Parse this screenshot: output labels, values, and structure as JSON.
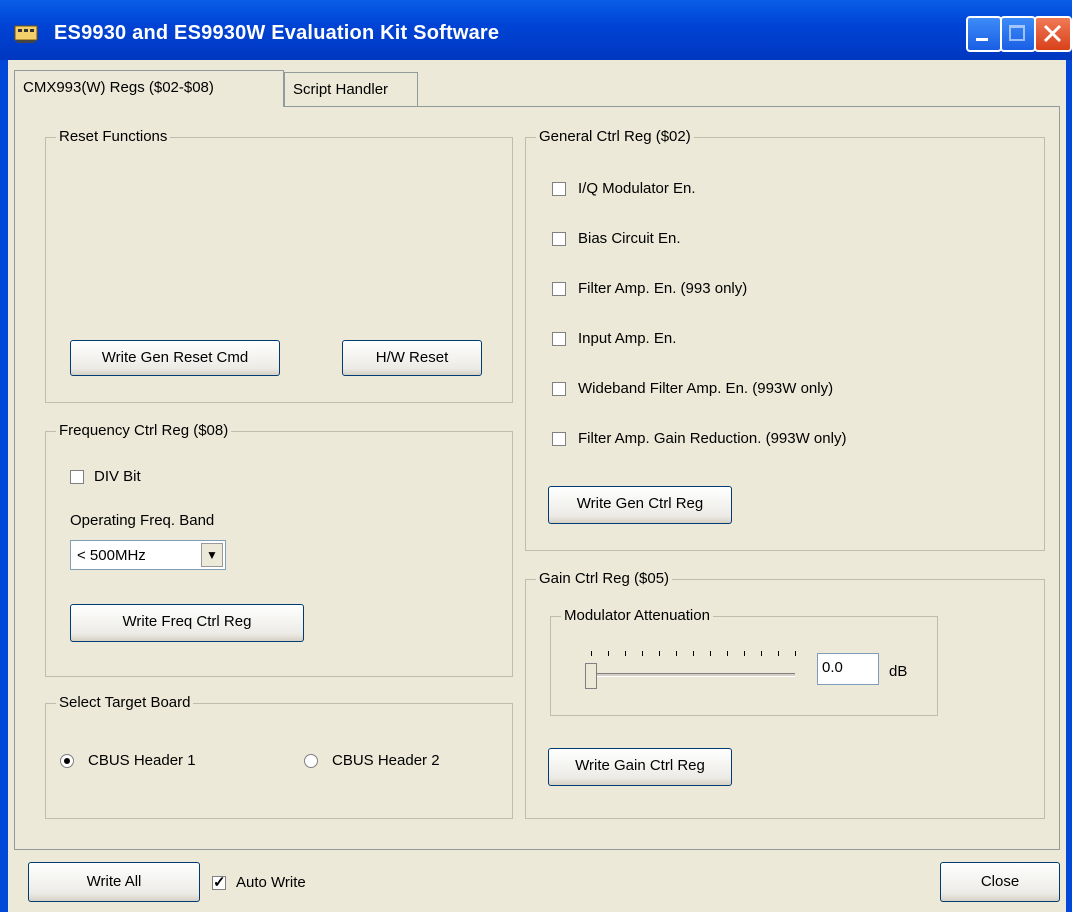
{
  "window": {
    "title": "ES9930 and ES9930W Evaluation Kit Software"
  },
  "tabs": [
    {
      "label": "CMX993(W) Regs ($02-$08)",
      "active": true
    },
    {
      "label": "Script Handler",
      "active": false
    }
  ],
  "reset": {
    "title": "Reset Functions",
    "write_gen_reset": "Write Gen Reset Cmd",
    "hw_reset": "H/W Reset"
  },
  "freq": {
    "title": "Frequency Ctrl Reg ($08)",
    "div_bit": {
      "label": "DIV Bit",
      "checked": false
    },
    "band_label": "Operating Freq. Band",
    "band_value": "< 500MHz",
    "write_btn": "Write Freq Ctrl Reg"
  },
  "target": {
    "title": "Select Target Board",
    "options": [
      {
        "label": "CBUS Header 1",
        "selected": true
      },
      {
        "label": "CBUS Header 2",
        "selected": false
      }
    ]
  },
  "general": {
    "title": "General Ctrl Reg ($02)",
    "checkboxes": [
      {
        "label": "I/Q Modulator En.",
        "checked": false
      },
      {
        "label": "Bias Circuit En.",
        "checked": false
      },
      {
        "label": "Filter Amp. En. (993 only)",
        "checked": false
      },
      {
        "label": "Input Amp. En.",
        "checked": false
      },
      {
        "label": "Wideband Filter Amp. En. (993W only)",
        "checked": false
      },
      {
        "label": "Filter Amp. Gain Reduction. (993W only)",
        "checked": false
      }
    ],
    "write_btn": "Write Gen Ctrl Reg"
  },
  "gain": {
    "title": "Gain Ctrl Reg ($05)",
    "mod_title": "Modulator Attenuation",
    "slider_fraction": 0,
    "value": "0.0",
    "unit": "dB",
    "write_btn": "Write Gain Ctrl Reg"
  },
  "bottom": {
    "write_all": "Write All",
    "auto_write": {
      "label": "Auto Write",
      "checked": true
    },
    "close": "Close"
  },
  "colors": {
    "titlebar": "#0044d6",
    "face": "#ece9d8",
    "close": "#d8411a"
  }
}
